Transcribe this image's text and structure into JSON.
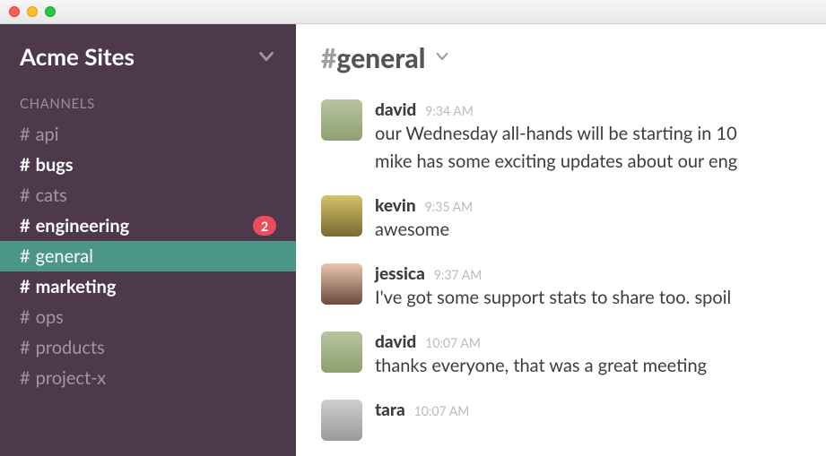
{
  "titlebar": {
    "buttons": [
      "close",
      "minimize",
      "zoom"
    ]
  },
  "sidebar": {
    "team_name": "Acme Sites",
    "section_label": "CHANNELS",
    "channels": [
      {
        "name": "api",
        "unread": false,
        "active": false,
        "badge": null
      },
      {
        "name": "bugs",
        "unread": true,
        "active": false,
        "badge": null
      },
      {
        "name": "cats",
        "unread": false,
        "active": false,
        "badge": null
      },
      {
        "name": "engineering",
        "unread": true,
        "active": false,
        "badge": 2
      },
      {
        "name": "general",
        "unread": false,
        "active": true,
        "badge": null
      },
      {
        "name": "marketing",
        "unread": true,
        "active": false,
        "badge": null
      },
      {
        "name": "ops",
        "unread": false,
        "active": false,
        "badge": null
      },
      {
        "name": "products",
        "unread": false,
        "active": false,
        "badge": null
      },
      {
        "name": "project-x",
        "unread": false,
        "active": false,
        "badge": null
      }
    ]
  },
  "channel_header": {
    "hash": "#",
    "name": "general"
  },
  "messages": [
    {
      "author": "david",
      "time": "9:34 AM",
      "avatar": "av-david",
      "text": "our Wednesday all-hands will be starting in 10\nmike has some exciting updates about our eng"
    },
    {
      "author": "kevin",
      "time": "9:35 AM",
      "avatar": "av-kevin",
      "text": "awesome"
    },
    {
      "author": "jessica",
      "time": "9:37 AM",
      "avatar": "av-jessica",
      "text": "I've got some support stats to share too. spoil"
    },
    {
      "author": "david",
      "time": "10:07 AM",
      "avatar": "av-david",
      "text": "thanks everyone, that was a great meeting"
    },
    {
      "author": "tara",
      "time": "10:07 AM",
      "avatar": "av-tara",
      "text": ""
    }
  ]
}
